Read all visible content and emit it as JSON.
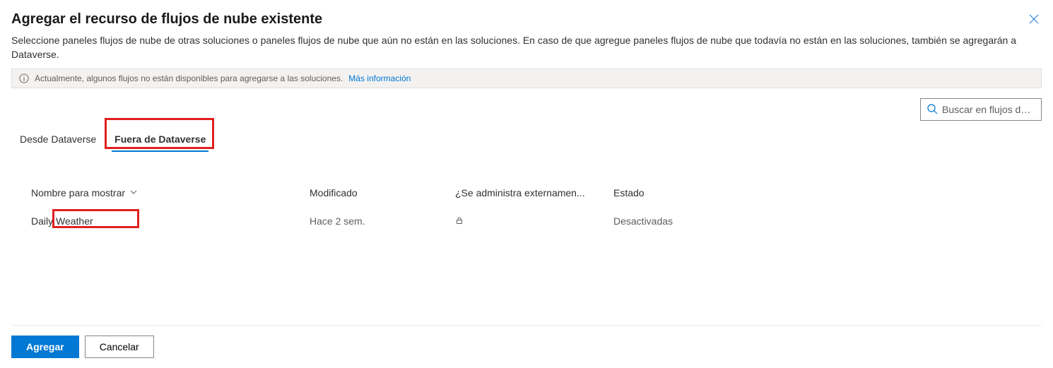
{
  "header": {
    "title": "Agregar el recurso de flujos de nube existente",
    "description": "Seleccione paneles flujos de nube de otras soluciones o paneles flujos de nube que aún no están en las soluciones. En caso de que agregue paneles flujos de nube que todavía no están en las soluciones, también se agregarán a Dataverse."
  },
  "info": {
    "message": "Actualmente, algunos flujos no están disponibles para agregarse a las soluciones.",
    "link_label": "Más información"
  },
  "search": {
    "placeholder": "Buscar en flujos de ..."
  },
  "tabs": [
    {
      "label": "Desde Dataverse",
      "active": false
    },
    {
      "label": "Fuera de Dataverse",
      "active": true
    }
  ],
  "table": {
    "columns": {
      "name": "Nombre para mostrar",
      "modified": "Modificado",
      "managed": "¿Se administra externamen...",
      "status": "Estado"
    },
    "rows": [
      {
        "name": "Daily Weather",
        "modified": "Hace 2 sem.",
        "managed_icon": "lock",
        "status": "Desactivadas"
      }
    ]
  },
  "footer": {
    "add": "Agregar",
    "cancel": "Cancelar"
  }
}
